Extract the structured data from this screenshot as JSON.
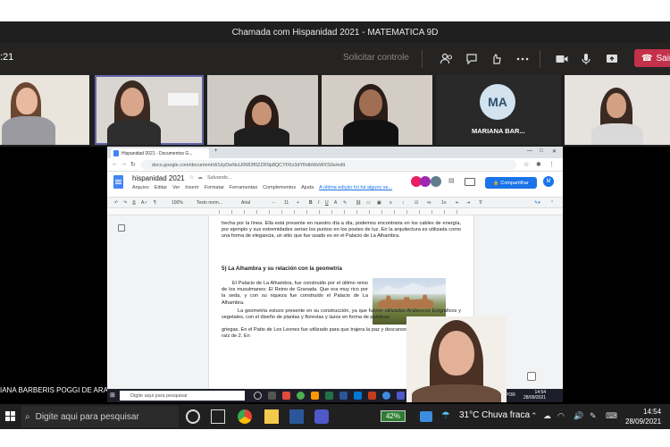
{
  "teams": {
    "title": "Chamada com Hispanidad 2021 - MATEMATICA 9D",
    "timer": ":21",
    "request_control": "Solicitar controle",
    "leave_label": "Sair"
  },
  "participants": {
    "avatar_initials": "MA",
    "avatar_name": "MARIANA BAR...",
    "presenter_label": "IANA BARBERIS POGGI DE ARAGAO"
  },
  "browser": {
    "tab_title": "Hispanidad 2021 - Documentos G...",
    "url": "docs.google.com/document/d/1dyDwNuU0583f0ZZR9p8QCYfXIz3dYRdbWsWXS0o/edit"
  },
  "docs": {
    "title": "hispanidad 2021",
    "saving": "Salvando...",
    "menu": [
      "Arquivo",
      "Editar",
      "Ver",
      "Inserir",
      "Formatar",
      "Ferramentas",
      "Complementos",
      "Ajuda"
    ],
    "last_edit": "A última edição foi há alguns se...",
    "share_label": "Compartilhar",
    "account_initial": "M",
    "toolbar": {
      "zoom": "100%",
      "style": "Texto norm...",
      "font": "Arial",
      "size": "11"
    },
    "paragraph1": "hecha por la línea. Ella está presente en nuestro día a día, podemos encontraria en los cables de energía, por ejemplo y sus extremidades serian los puntos en los postes de luz. En la arquitectura es utilizada como una forma de elegancia, un sitio que fue usado es en el Palacio de La Alhambra.",
    "heading": "5)    La Alhambra y su relación con la geometría",
    "paragraph2": "El Palacio de La Alhambra, fue construido por el último reino de los musulmanes: El Reino de Granada. Que era muy rico por la seda, y con su riqueza fue construido el Palacio de La Alhambra.",
    "paragraph3a": "La geometría estuvo presente en su construcción, ya que fueron utilizados Arabescos Epigráficos y vegetales, con el diseño de plantas y florestas y lazos en forma de palabras",
    "paragraph3b": "griegas. En el Patio de Los Leones fue utilizado para que trajera la paz y descanso la forma del Rectángulo raíz de 2. En"
  },
  "inner_taskbar": {
    "search": "Digite aqui para pesquisar",
    "lang": "POR",
    "time": "14:54",
    "date": "28/09/2021"
  },
  "taskbar": {
    "search_placeholder": "Digite aqui para pesquisar",
    "battery": "42%",
    "weather": "31°C  Chuva fraca",
    "time": "14:54",
    "date": "28/09/2021"
  },
  "colors": {
    "teams_bg": "#252423",
    "teams_accent": "#6264a7",
    "leave_red": "#c4314b",
    "docs_blue": "#1a73e8",
    "battery_green": "#2e7d32"
  }
}
